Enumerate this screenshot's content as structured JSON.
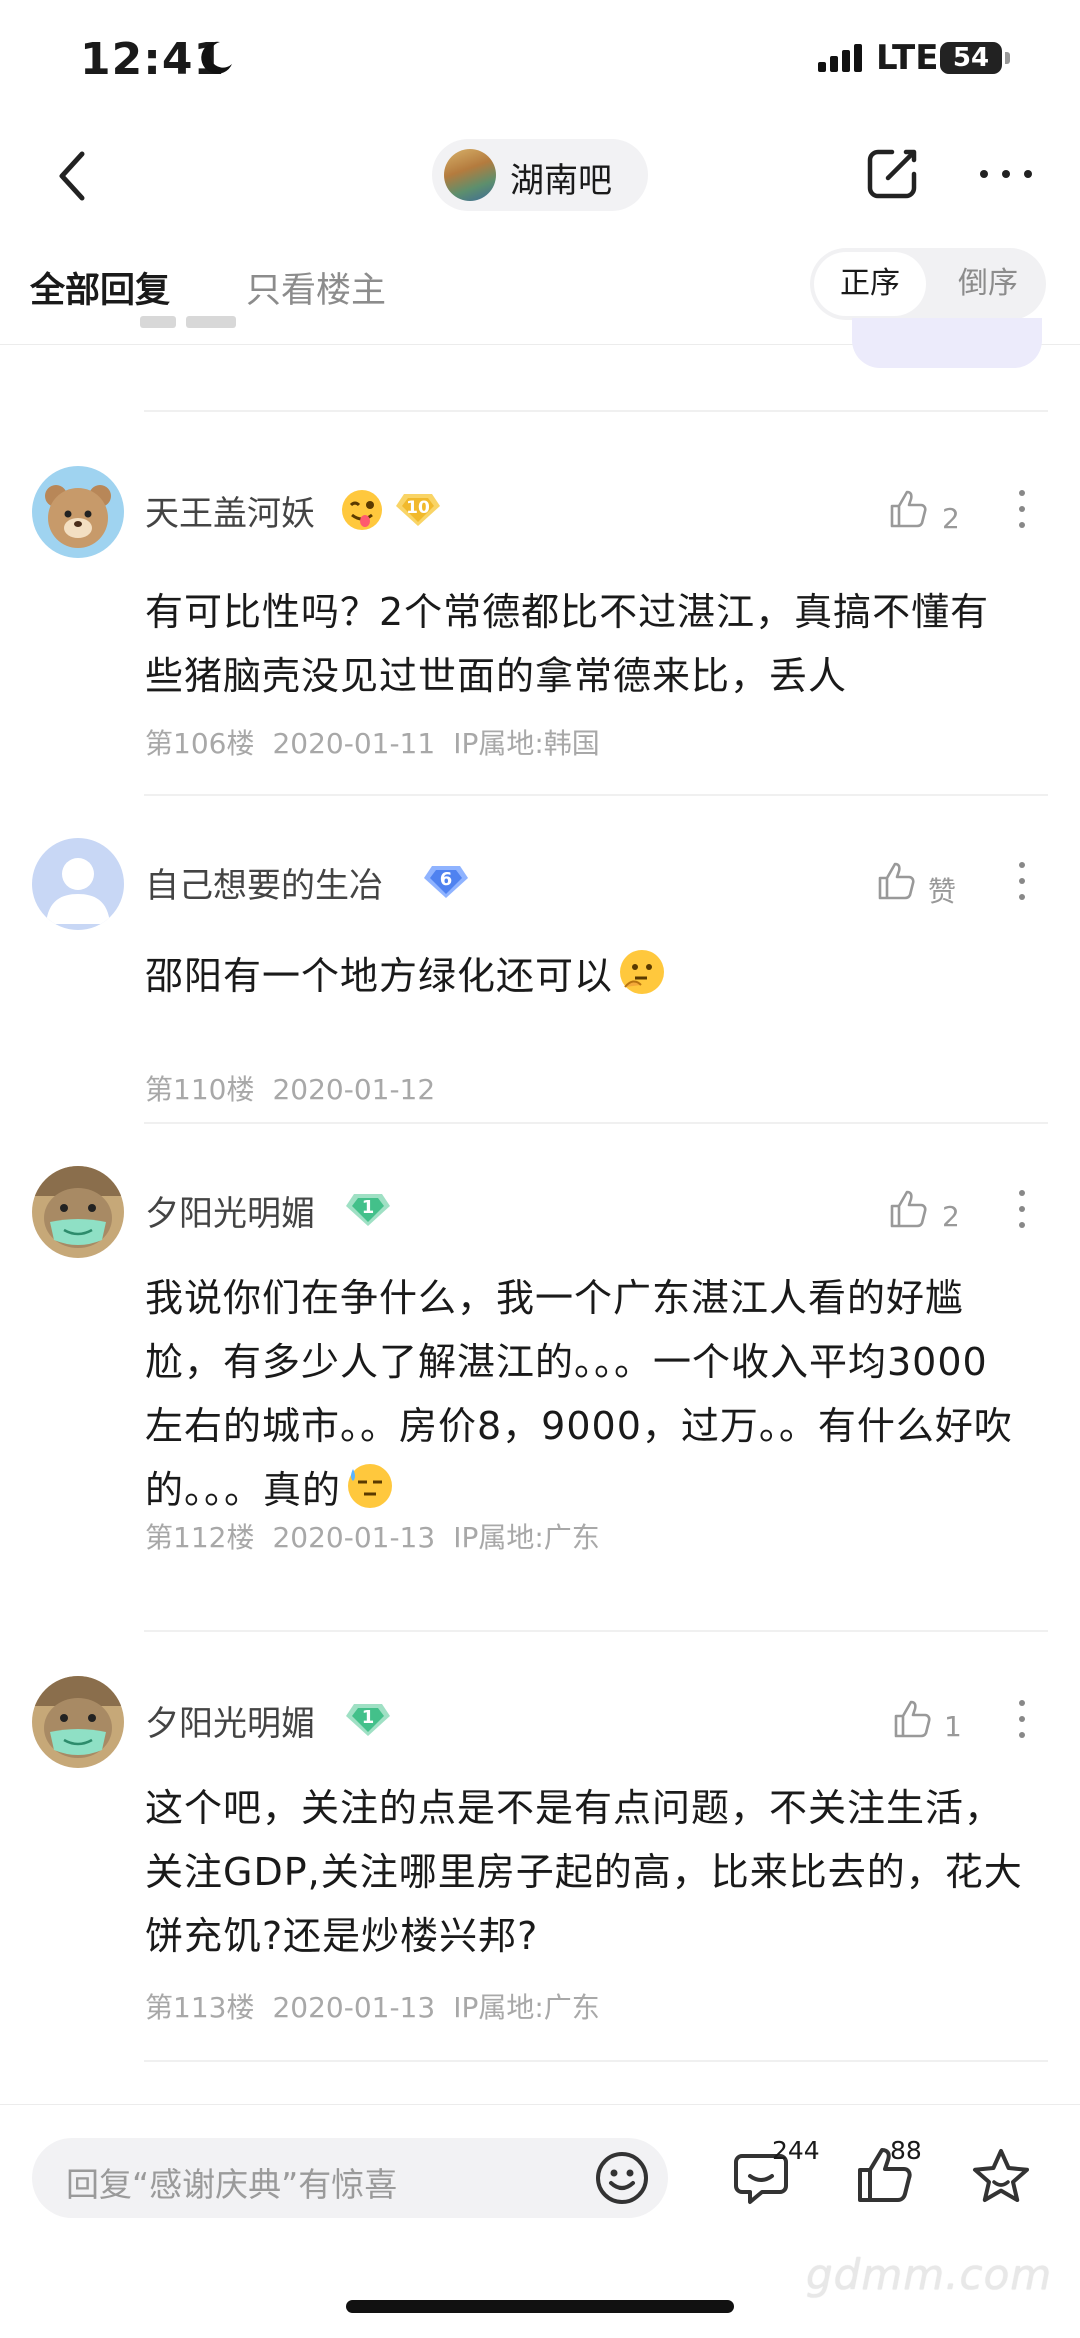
{
  "status_bar": {
    "time": "12:41",
    "network": "LTE",
    "battery": "54"
  },
  "header": {
    "forum_name": "湖南吧"
  },
  "tabs": {
    "all_replies": "全部回复",
    "host_only": "只看楼主",
    "order_asc": "正序",
    "order_desc": "倒序"
  },
  "posts": [
    {
      "username": "天王盖河妖",
      "level": "10",
      "likes": "2",
      "content": "有可比性吗？2个常德都比不过湛江，真搞不懂有些猪脑壳没见过世面的拿常德来比，丢人",
      "floor": "第106楼",
      "date": "2020-01-11",
      "ip": "IP属地:韩国"
    },
    {
      "username": "自己想要的生冶",
      "level": "6",
      "likes": "赞",
      "content": "邵阳有一个地方绿化还可以",
      "floor": "第110楼",
      "date": "2020-01-12"
    },
    {
      "username": "夕阳光明媚",
      "level": "1",
      "likes": "2",
      "content": "我说你们在争什么，我一个广东湛江人看的好尴尬，有多少人了解湛江的。。。一个收入平均3000左右的城市。。房价8，9000，过万。。有什么好吹的。。。真的",
      "floor": "第112楼",
      "date": "2020-01-13",
      "ip": "IP属地:广东"
    },
    {
      "username": "夕阳光明媚",
      "level": "1",
      "likes": "1",
      "content": "这个吧，关注的点是不是有点问题，不关注生活，关注GDP,关注哪里房子起的高，比来比去的，花大饼充饥?还是炒楼兴邦?",
      "floor": "第113楼",
      "date": "2020-01-13",
      "ip": "IP属地:广东"
    }
  ],
  "bottom_bar": {
    "reply_placeholder": "回复“感谢庆典”有惊喜",
    "comment_count": "244",
    "like_count": "88"
  },
  "watermark": "gdmm.com",
  "icons": {
    "back": "chevron-left-icon",
    "edit": "edit-icon",
    "more": "more-dots-icon",
    "like": "thumbs-up-icon",
    "emoji": "smile-icon",
    "comment": "comment-icon",
    "favorite": "star-icon"
  }
}
